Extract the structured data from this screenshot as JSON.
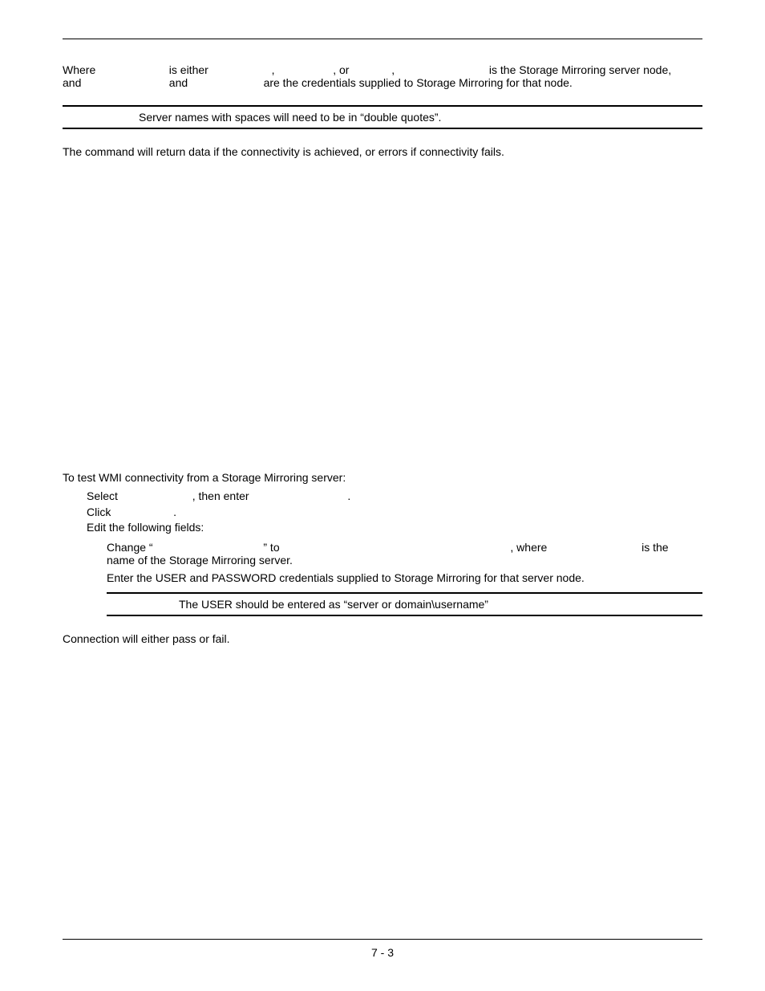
{
  "intro": {
    "line1_a": "Where",
    "line1_b": "is either",
    "line1_c": ",",
    "line1_d": ", or",
    "line1_e": ",",
    "line1_f": "is the Storage Mirroring server node,",
    "line2_a": "and",
    "line2_b": "and",
    "line2_c": "are the credentials supplied to Storage Mirroring for that node."
  },
  "note1": "Server names with spaces will need to be in “double quotes”.",
  "para1": "The command will return data if the connectivity is achieved, or errors if connectivity fails.",
  "section2": {
    "heading": "To test WMI connectivity from a Storage Mirroring server:",
    "step1_a": "Select",
    "step1_b": ", then enter",
    "step1_c": ".",
    "step2_a": "Click",
    "step2_b": ".",
    "step3": "Edit the following fields:",
    "sub1_a": "Change “",
    "sub1_b": "” to",
    "sub1_c": ", where",
    "sub1_d": "is the",
    "sub1_e": "name of the Storage Mirroring server.",
    "sub2": "Enter the USER and PASSWORD credentials supplied to Storage Mirroring for that server node."
  },
  "note2": "The USER should be entered as “server or domain\\username”",
  "para2": "Connection will either pass or fail.",
  "footer": "7 - 3"
}
